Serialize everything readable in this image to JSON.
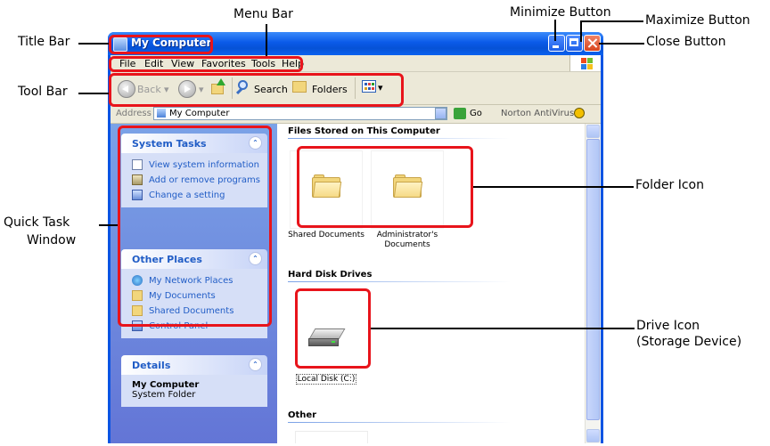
{
  "callouts": {
    "title_bar": "Title Bar",
    "menu_bar": "Menu Bar",
    "minimize_button": "Minimize Button",
    "maximize_button": "Maximize Button",
    "close_button": "Close Button",
    "tool_bar": "Tool Bar",
    "quick_task_window_1": "Quick Task",
    "quick_task_window_2": "Window",
    "folder_icon": "Folder Icon",
    "drive_icon_1": "Drive Icon",
    "drive_icon_2": "(Storage Device)"
  },
  "window": {
    "title": "My Computer"
  },
  "menu": {
    "items": [
      "File",
      "Edit",
      "View",
      "Favorites",
      "Tools",
      "Help"
    ]
  },
  "toolbar": {
    "back_label": "Back",
    "search_label": "Search",
    "folders_label": "Folders"
  },
  "address": {
    "label": "Address",
    "value": "My Computer",
    "go_label": "Go",
    "norton_label": "Norton AntiVirus"
  },
  "task_pane": {
    "system_tasks": {
      "title": "System Tasks",
      "items": [
        "View system information",
        "Add or remove programs",
        "Change a setting"
      ]
    },
    "other_places": {
      "title": "Other Places",
      "items": [
        "My Network Places",
        "My Documents",
        "Shared Documents",
        "Control Panel"
      ]
    },
    "details": {
      "title": "Details",
      "name": "My Computer",
      "type": "System Folder"
    }
  },
  "main": {
    "files_section_title": "Files Stored on This Computer",
    "folders": [
      "Shared Documents",
      "Administrator's Documents"
    ],
    "hard_disk_section_title": "Hard Disk Drives",
    "drives": [
      "Local Disk (C:)"
    ],
    "other_section_title": "Other"
  },
  "colors": {
    "callout_red": "#e8141b",
    "title_blue": "#0a5ae8",
    "task_pane_blue": "#6f8ee0",
    "link_blue": "#215dc6"
  }
}
